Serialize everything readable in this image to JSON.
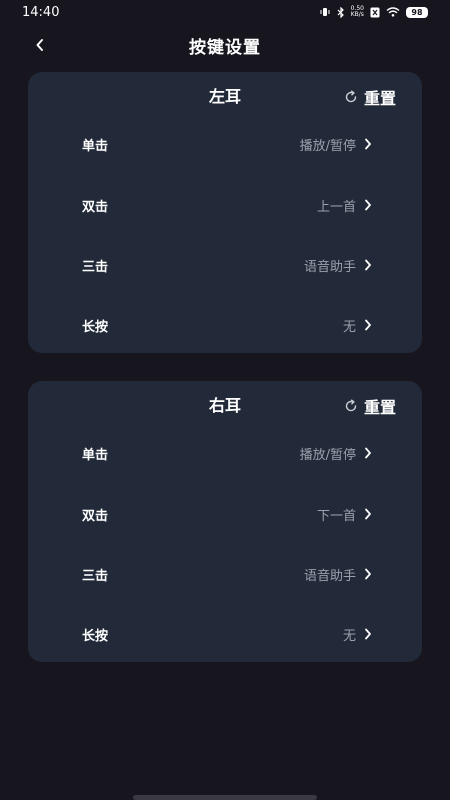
{
  "status_bar": {
    "time": "14:40",
    "net_speed_value": "0.50",
    "net_speed_unit": "KB/s",
    "battery": "98"
  },
  "header": {
    "title": "按键设置"
  },
  "left_card": {
    "title": "左耳",
    "reset_label": "重置",
    "rows": [
      {
        "label": "单击",
        "value": "播放/暂停"
      },
      {
        "label": "双击",
        "value": "上一首"
      },
      {
        "label": "三击",
        "value": "语音助手"
      },
      {
        "label": "长按",
        "value": "无"
      }
    ]
  },
  "right_card": {
    "title": "右耳",
    "reset_label": "重置",
    "rows": [
      {
        "label": "单击",
        "value": "播放/暂停"
      },
      {
        "label": "双击",
        "value": "下一首"
      },
      {
        "label": "三击",
        "value": "语音助手"
      },
      {
        "label": "长按",
        "value": "无"
      }
    ]
  },
  "colors": {
    "background": "#17161e",
    "card": "#222a39",
    "value_text": "#9aa0ab"
  }
}
